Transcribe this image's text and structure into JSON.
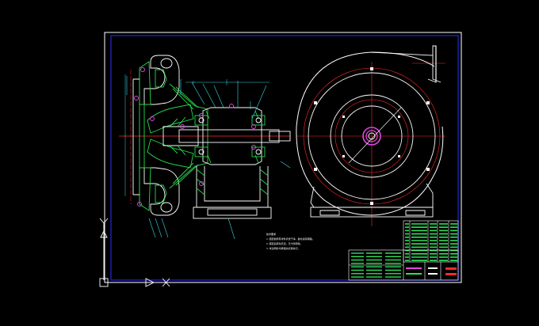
{
  "drawing": {
    "technical_notes": {
      "heading": "技术要求",
      "lines": [
        "1.装配前所有零件清洗干净，各处涂润滑脂。",
        "2.装配后转动灵活，无卡滞现象。",
        "3.未注明处均按相关标准执行。"
      ]
    },
    "ucs": {
      "y_label": "Y",
      "x_label": "X"
    },
    "colors": {
      "background": "#000000",
      "frame": "#1c1ca8",
      "outline": "#ffffff",
      "hatch": "#27d84a",
      "centerline": "#ff2a2a",
      "dimension": "#38d8e8",
      "balloon": "#e048e0",
      "table_text": "#2ee058"
    }
  }
}
